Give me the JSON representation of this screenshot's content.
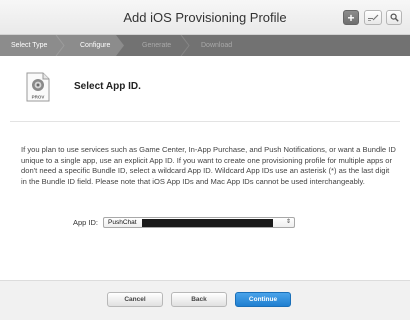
{
  "window": {
    "title": "Add iOS Provisioning Profile",
    "toolbar": {
      "add_icon": "plus-icon",
      "edit_icon": "pencil-icon",
      "search_icon": "magnifier-icon"
    }
  },
  "steps": [
    {
      "label": "Select Type",
      "state": "done"
    },
    {
      "label": "Configure",
      "state": "active"
    },
    {
      "label": "Generate",
      "state": "pending"
    },
    {
      "label": "Download",
      "state": "pending"
    }
  ],
  "header": {
    "icon_label": "PROV",
    "title": "Select App ID."
  },
  "description": "If you plan to use services such as Game Center, In-App Purchase, and Push Notifications, or want a Bundle ID unique to a single app, use an explicit App ID. If you want to create one provisioning profile for multiple apps or don't need a specific Bundle ID, select a wildcard App ID. Wildcard App IDs use an asterisk (*) as the last digit in the Bundle ID field. Please note that iOS App IDs and Mac App IDs cannot be used interchangeably.",
  "form": {
    "app_id_label": "App ID:",
    "app_id_value": "PushChat"
  },
  "footer": {
    "cancel_label": "Cancel",
    "back_label": "Back",
    "continue_label": "Continue"
  },
  "colors": {
    "accent": "#2a8ae0",
    "steps_bar": "#727272",
    "steps_active": "#8c8c8c"
  }
}
